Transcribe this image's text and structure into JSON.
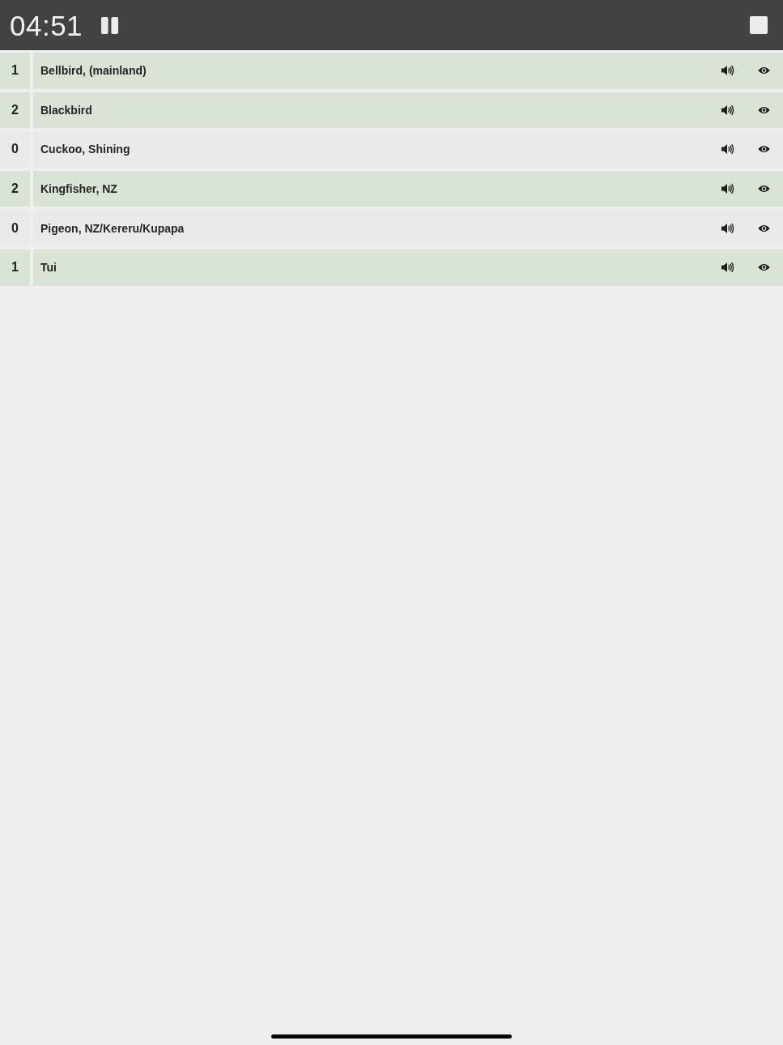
{
  "header": {
    "timer": "04:51"
  },
  "birds": [
    {
      "count": "1",
      "name": "Bellbird, (mainland)",
      "spotted": true
    },
    {
      "count": "2",
      "name": "Blackbird",
      "spotted": true
    },
    {
      "count": "0",
      "name": "Cuckoo, Shining",
      "spotted": false
    },
    {
      "count": "2",
      "name": "Kingfisher, NZ",
      "spotted": true
    },
    {
      "count": "0",
      "name": "Pigeon, NZ/Kereru/Kupapa",
      "spotted": false
    },
    {
      "count": "1",
      "name": "Tui",
      "spotted": true
    }
  ]
}
